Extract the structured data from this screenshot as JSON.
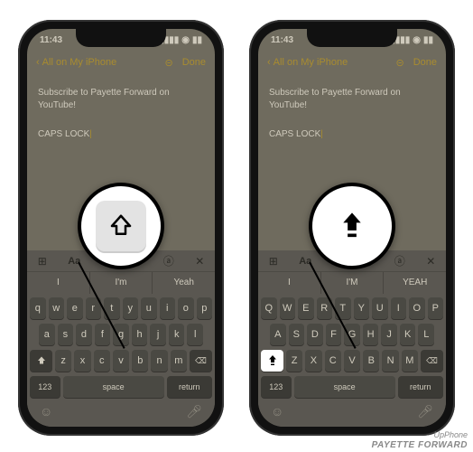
{
  "statusbar": {
    "time": "11:43"
  },
  "nav": {
    "back_label": "All on My iPhone",
    "done_label": "Done"
  },
  "note": {
    "line1": "Subscribe to Payette Forward on YouTube!",
    "line2": "CAPS LOCK"
  },
  "toolbar": {
    "aa": "Aa"
  },
  "suggestions_lower": [
    "I",
    "I'm",
    "Yeah"
  ],
  "suggestions_upper": [
    "I",
    "I'M",
    "YEAH"
  ],
  "keys_lower_r1": [
    "q",
    "w",
    "e",
    "r",
    "t",
    "y",
    "u",
    "i",
    "o",
    "p"
  ],
  "keys_lower_r2": [
    "a",
    "s",
    "d",
    "f",
    "g",
    "h",
    "j",
    "k",
    "l"
  ],
  "keys_lower_r3": [
    "z",
    "x",
    "c",
    "v",
    "b",
    "n",
    "m"
  ],
  "keys_upper_r1": [
    "Q",
    "W",
    "E",
    "R",
    "T",
    "Y",
    "U",
    "I",
    "O",
    "P"
  ],
  "keys_upper_r2": [
    "A",
    "S",
    "D",
    "F",
    "G",
    "H",
    "J",
    "K",
    "L"
  ],
  "keys_upper_r3": [
    "Z",
    "X",
    "C",
    "V",
    "B",
    "N",
    "M"
  ],
  "bottomrow": {
    "numbers": "123",
    "space": "space",
    "return": "return"
  },
  "watermark": {
    "line1": "UpPhone",
    "line2": "PAYETTE FORWARD"
  }
}
